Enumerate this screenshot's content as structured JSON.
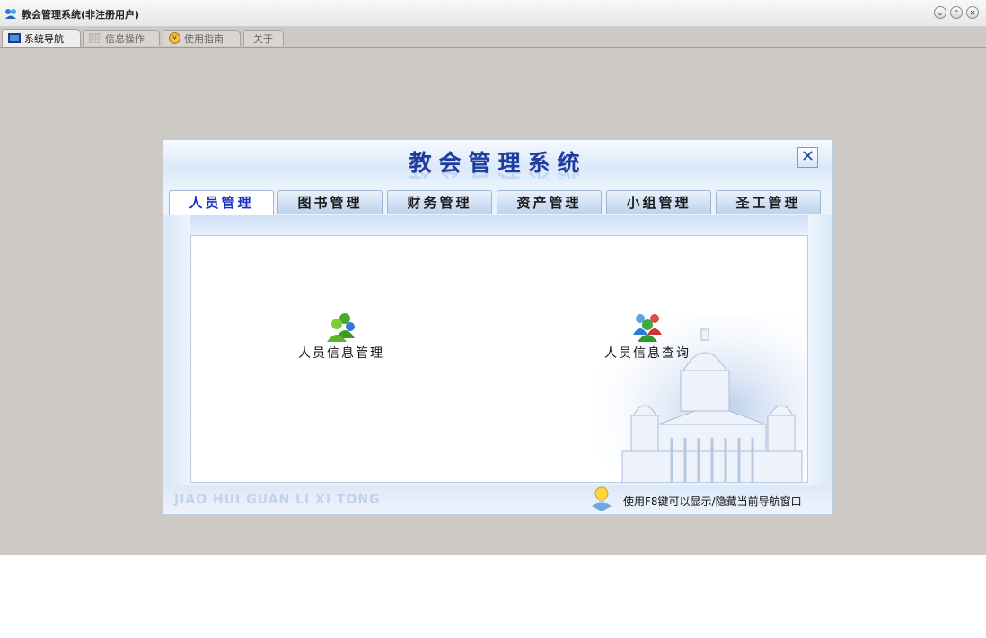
{
  "window": {
    "title": "教会管理系统(非注册用户)",
    "controls": [
      "⌄",
      "⌃",
      "✕"
    ]
  },
  "app_tabs": [
    {
      "label": "系统导航",
      "icon": "monitor-icon",
      "active": true
    },
    {
      "label": "信息操作",
      "icon": "grid-icon",
      "active": false
    },
    {
      "label": "使用指南",
      "icon": "coin-icon",
      "active": false
    },
    {
      "label": "关于",
      "icon": "",
      "active": false
    }
  ],
  "panel": {
    "title": "教会管理系统",
    "close_label": "✕",
    "nav_tabs": [
      {
        "label": "人员管理",
        "active": true
      },
      {
        "label": "图书管理",
        "active": false
      },
      {
        "label": "财务管理",
        "active": false
      },
      {
        "label": "资产管理",
        "active": false
      },
      {
        "label": "小组管理",
        "active": false
      },
      {
        "label": "圣工管理",
        "active": false
      }
    ],
    "functions": [
      {
        "label": "人员信息管理",
        "icon": "users-green-icon"
      },
      {
        "label": "人员信息查询",
        "icon": "users-group-icon"
      }
    ],
    "footer_brand": "JIAO HUI GUAN LI XI TONG",
    "footer_tip": "使用F8键可以显示/隐藏当前导航窗口"
  },
  "colors": {
    "desktop_bg": "#cdc9c4",
    "title_blue": "#1e3c9c",
    "active_tab_text": "#1a2ec0",
    "panel_bg": "#eaf2fc"
  }
}
